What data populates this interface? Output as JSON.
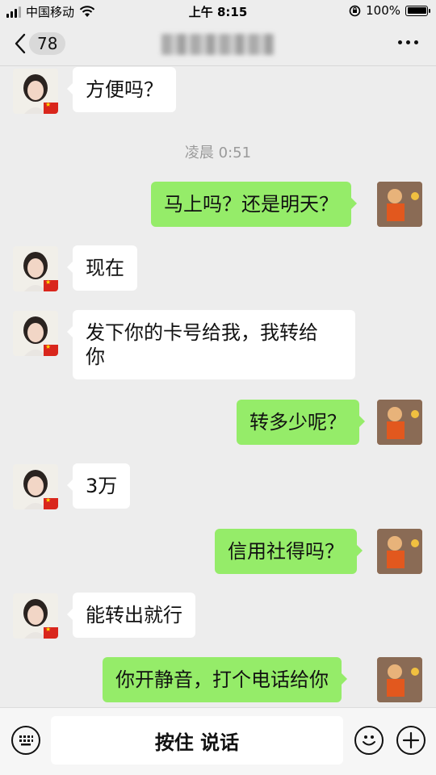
{
  "status_bar": {
    "carrier": "中国移动",
    "time": "上午 8:15",
    "battery": "100%",
    "battery_level": 1.0
  },
  "nav": {
    "unread_count": "78",
    "title": ""
  },
  "messages": [
    {
      "side": "left",
      "text": "方便吗？"
    },
    {
      "side": "timestamp",
      "text": "凌晨 0:51"
    },
    {
      "side": "right",
      "text": "马上吗？还是明天？"
    },
    {
      "side": "left",
      "text": "现在"
    },
    {
      "side": "left",
      "text_line1": "发下你的卡号给我，我转给",
      "text_line2": "你"
    },
    {
      "side": "right",
      "text": "转多少呢？"
    },
    {
      "side": "left",
      "text": "3万"
    },
    {
      "side": "right",
      "text": "信用社得吗？"
    },
    {
      "side": "left",
      "text": "能转出就行"
    },
    {
      "side": "right",
      "text": "你开静音，打个电话给你"
    }
  ],
  "input_bar": {
    "hold_to_talk": "按住 说话",
    "icons": [
      "keyboard-icon",
      "emoji-icon",
      "plus-icon"
    ]
  },
  "colors": {
    "background": "#ededed",
    "bubble_self": "#95ec69",
    "bubble_other": "#ffffff"
  }
}
